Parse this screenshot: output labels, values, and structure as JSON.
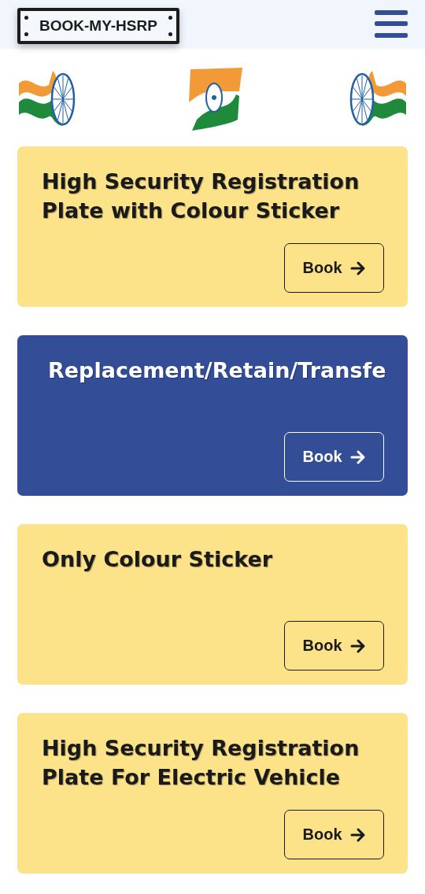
{
  "header": {
    "logo": "BOOK-MY-HSRP"
  },
  "cards": [
    {
      "kind": "light",
      "title": "High Security Registration Plate with Colour Sticker",
      "button": "Book"
    },
    {
      "kind": "dark",
      "title": "Replacement/Retain/Transfe",
      "button": "Book"
    },
    {
      "kind": "light",
      "title": "Only Colour Sticker",
      "button": "Book"
    },
    {
      "kind": "light",
      "title": "High Security Registration Plate For Electric Vehicle",
      "button": "Book"
    }
  ]
}
